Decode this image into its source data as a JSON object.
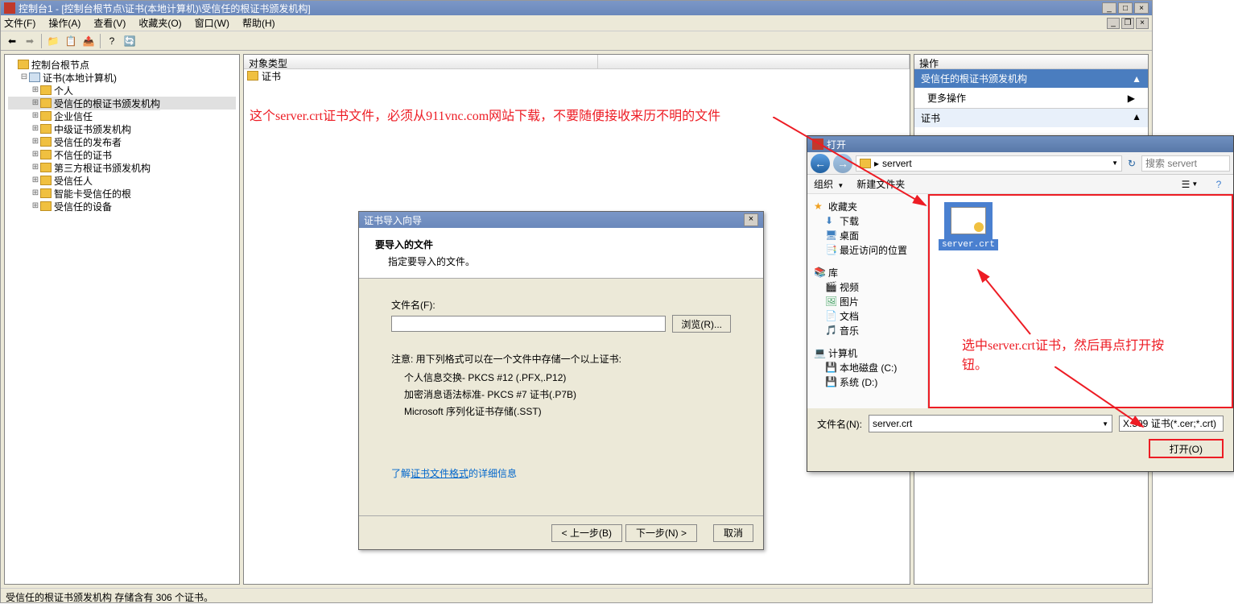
{
  "window": {
    "title": "控制台1 - [控制台根节点\\证书(本地计算机)\\受信任的根证书颁发机构]"
  },
  "menu": {
    "file": "文件(F)",
    "action": "操作(A)",
    "view": "查看(V)",
    "favorites": "收藏夹(O)",
    "window": "窗口(W)",
    "help": "帮助(H)"
  },
  "tree": {
    "root": "控制台根节点",
    "certs": "证书(本地计算机)",
    "personal": "个人",
    "trusted_root": "受信任的根证书颁发机构",
    "enterprise": "企业信任",
    "intermediate": "中级证书颁发机构",
    "trusted_pub": "受信任的发布者",
    "untrusted": "不信任的证书",
    "third_party": "第三方根证书颁发机构",
    "trusted_people": "受信任人",
    "smartcard": "智能卡受信任的根",
    "trusted_dev": "受信任的设备"
  },
  "center": {
    "col": "对象类型",
    "row1": "证书"
  },
  "actions": {
    "title": "操作",
    "section": "受信任的根证书颁发机构",
    "more": "更多操作",
    "section2": "证书"
  },
  "status": "受信任的根证书颁发机构 存储含有 306 个证书。",
  "wizard": {
    "title": "证书导入向导",
    "h": "要导入的文件",
    "sub": "指定要导入的文件。",
    "filename_label": "文件名(F):",
    "filename_value": "",
    "browse": "浏览(R)...",
    "note": "注意: 用下列格式可以在一个文件中存储一个以上证书:",
    "f1": "个人信息交换- PKCS #12 (.PFX,.P12)",
    "f2": "加密消息语法标准- PKCS #7 证书(.P7B)",
    "f3": "Microsoft 序列化证书存储(.SST)",
    "link_pre": "了解",
    "link": "证书文件格式",
    "link_post": "的详细信息",
    "back": "< 上一步(B)",
    "next": "下一步(N) >",
    "cancel": "取消"
  },
  "open": {
    "title": "打开",
    "breadcrumb": "servert",
    "search_ph": "搜索 servert",
    "organize": "组织",
    "newfolder": "新建文件夹",
    "sb_fav": "收藏夹",
    "sb_dl": "下载",
    "sb_desk": "桌面",
    "sb_recent": "最近访问的位置",
    "sb_lib": "库",
    "sb_video": "视频",
    "sb_pic": "图片",
    "sb_doc": "文档",
    "sb_music": "音乐",
    "sb_comp": "计算机",
    "sb_c": "本地磁盘 (C:)",
    "sb_d": "系统 (D:)",
    "file_selected": "server.crt",
    "fn_label": "文件名(N):",
    "fn_value": "server.crt",
    "filter": "X.509 证书(*.cer;*.crt)",
    "open_btn": "打开(O)"
  },
  "annot": {
    "top": "这个server.crt证书文件，必须从911vnc.com网站下载，不要随便接收来历不明的文件",
    "right": "选中server.crt证书，然后再点打开按钮。"
  }
}
